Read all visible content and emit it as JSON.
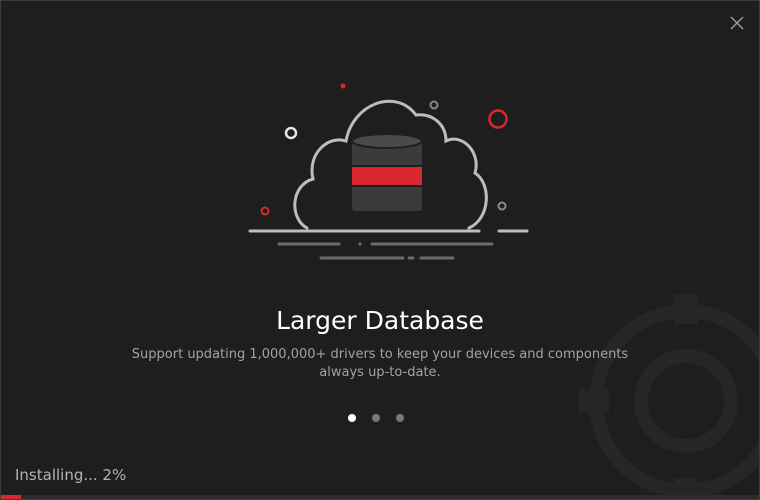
{
  "window": {
    "close_icon": "close-icon"
  },
  "slide": {
    "title": "Larger Database",
    "description": "Support updating 1,000,000+ drivers to keep your devices and components always up-to-date.",
    "illustration_icon": "cloud-database-icon"
  },
  "carousel": {
    "count": 3,
    "active_index": 0
  },
  "install": {
    "status": "Installing... 2%",
    "progress": 0.02
  },
  "colors": {
    "accent": "#d9272e",
    "background": "#1e1e1e",
    "text": "#ffffff",
    "muted_text": "#a3a3a3"
  }
}
